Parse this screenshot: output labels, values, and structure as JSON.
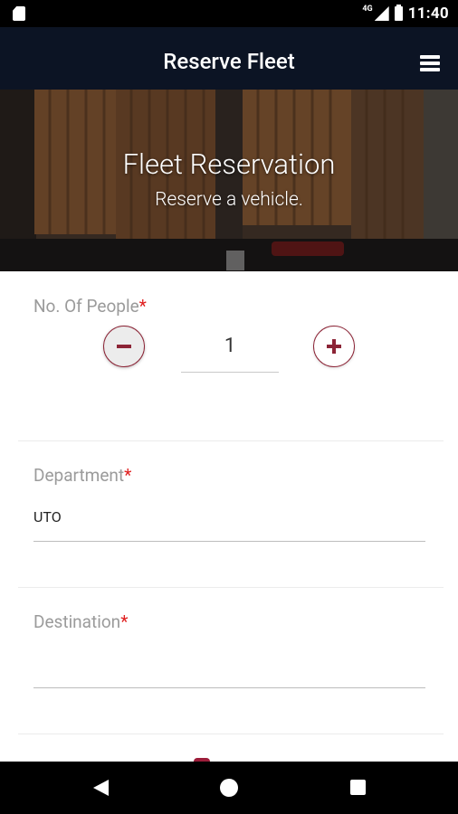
{
  "status_bar": {
    "time": "11:40",
    "network": "4G",
    "icons": [
      "sim-card-icon",
      "signal-icon",
      "battery-icon"
    ]
  },
  "app_bar": {
    "title": "Reserve Fleet",
    "menu_icon": "hamburger-menu-icon"
  },
  "hero": {
    "title": "Fleet Reservation",
    "subtitle": "Reserve a vehicle."
  },
  "form": {
    "people": {
      "label": "No. Of People",
      "required_mark": "*",
      "value": "1",
      "minus_icon": "minus-icon",
      "plus_icon": "plus-icon"
    },
    "department": {
      "label": "Department",
      "required_mark": "*",
      "value": "UTO"
    },
    "destination": {
      "label": "Destination",
      "required_mark": "*",
      "value": ""
    }
  },
  "colors": {
    "app_bar": "#0c1424",
    "accent": "#8c2436",
    "required": "#e02020",
    "label": "#9b9b9b"
  },
  "nav_bar": {
    "icons": [
      "back-icon",
      "home-icon",
      "recents-icon"
    ]
  }
}
